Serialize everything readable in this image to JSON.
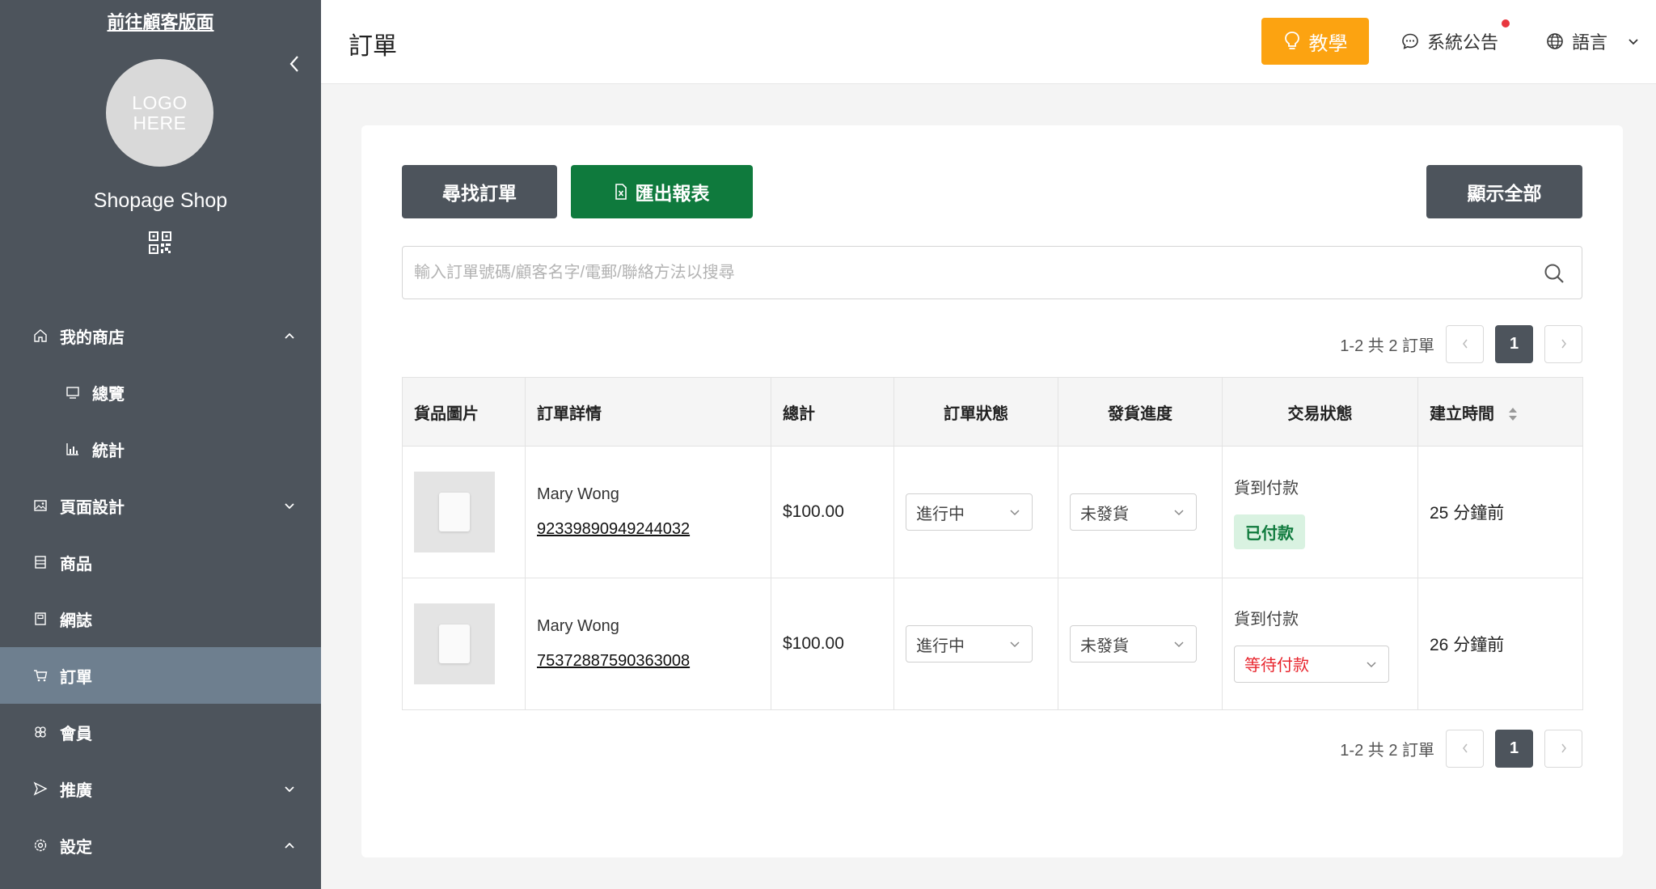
{
  "sidebar": {
    "customer_link": "前往顧客版面",
    "logo_line1": "LOGO",
    "logo_line2": "HERE",
    "shop_name": "Shopage Shop",
    "items": [
      {
        "label": "我的商店"
      },
      {
        "label": "總覽"
      },
      {
        "label": "統計"
      },
      {
        "label": "頁面設計"
      },
      {
        "label": "商品"
      },
      {
        "label": "網誌"
      },
      {
        "label": "訂單"
      },
      {
        "label": "會員"
      },
      {
        "label": "推廣"
      },
      {
        "label": "設定"
      }
    ]
  },
  "header": {
    "title": "訂單",
    "tutorial_label": "教學",
    "announcement_label": "系統公告",
    "language_label": "語言"
  },
  "toolbar": {
    "find_label": "尋找訂單",
    "export_label": "匯出報表",
    "show_all_label": "顯示全部"
  },
  "search": {
    "placeholder": "輸入訂單號碼/顧客名字/電郵/聯絡方法以搜尋"
  },
  "pagination": {
    "summary": "1-2 共 2 訂單",
    "current_page": "1"
  },
  "table": {
    "headers": [
      "貨品圖片",
      "訂單詳情",
      "總計",
      "訂單狀態",
      "發貨進度",
      "交易狀態",
      "建立時間"
    ],
    "rows": [
      {
        "customer": "Mary Wong",
        "order_no": "92339890949244032",
        "total": "$100.00",
        "order_status": "進行中",
        "shipping_status": "未發貨",
        "payment_method": "貨到付款",
        "payment_status": "已付款",
        "created": "25 分鐘前"
      },
      {
        "customer": "Mary Wong",
        "order_no": "75372887590363008",
        "total": "$100.00",
        "order_status": "進行中",
        "shipping_status": "未發貨",
        "payment_method": "貨到付款",
        "payment_status": "等待付款",
        "created": "26 分鐘前"
      }
    ]
  },
  "colors": {
    "sidebar_bg": "#4d545c",
    "active_item": "#6e7f8f",
    "tutorial": "#fca311",
    "export": "#0f7a3d",
    "paid_badge_bg": "#d9f2e1",
    "pending_text": "#e8262e",
    "notification_dot": "#e8363e"
  }
}
